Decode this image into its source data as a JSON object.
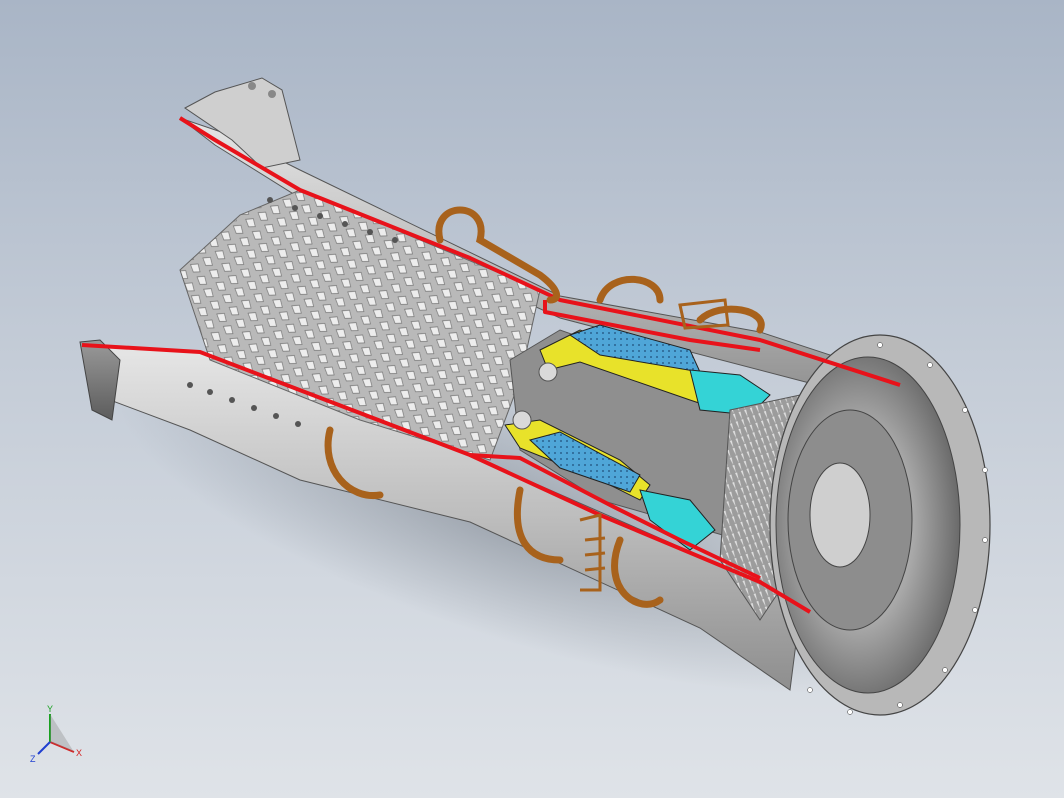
{
  "viewport": {
    "background_top": "#a9b5c6",
    "background_bottom": "#dfe3e8"
  },
  "model": {
    "section_color": "#e8121a",
    "casing_color": "#c8c8c8",
    "pipe_color": "#a8621c",
    "combustor_liner_color": "#e8e22a",
    "combustor_cooling_color": "#4fa6d8",
    "transition_duct_color": "#34d3d6"
  },
  "triad": {
    "x_label": "X",
    "y_label": "Y",
    "z_label": "Z",
    "x_color": "#d42020",
    "y_color": "#18a020",
    "z_color": "#2040d0"
  }
}
